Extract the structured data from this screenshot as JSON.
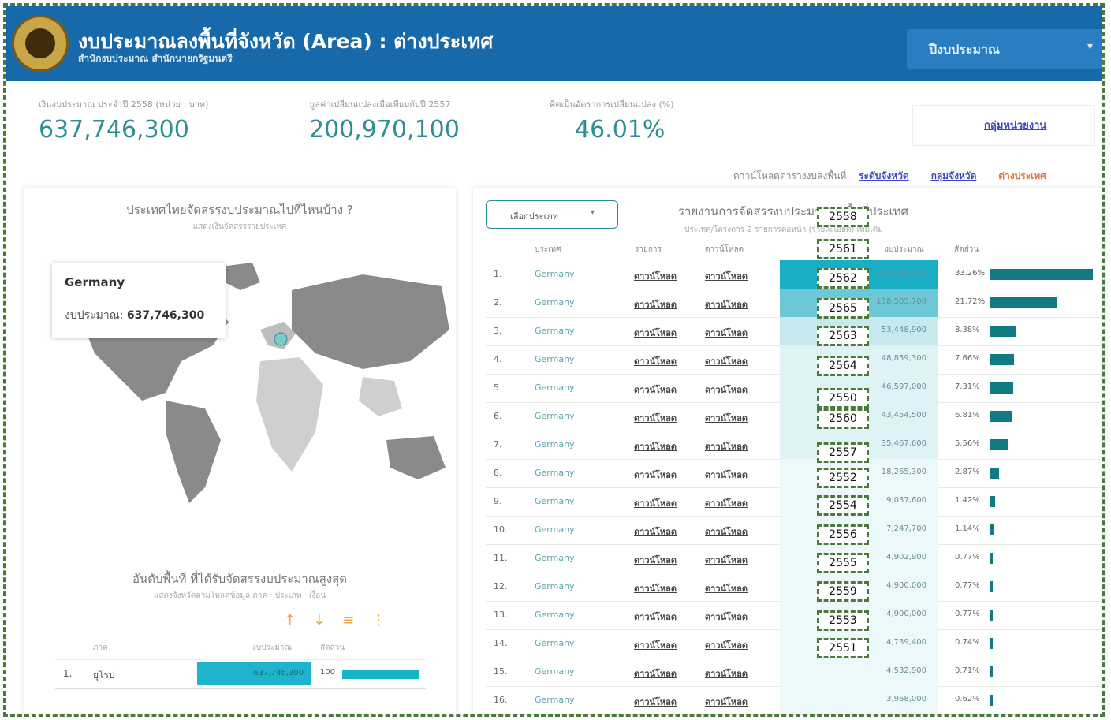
{
  "header": {
    "title": "งบประมาณลงพื้นที่จังหวัด (Area) : ต่างประเทศ",
    "subtitle": "สำนักงบประมาณ สำนักนายกรัฐมนตรี",
    "year_select": "ปีงบประมาณ"
  },
  "kpis": [
    {
      "label": "เงินงบประมาณ ประจำปี 2558 (หน่วย : บาท)",
      "value": "637,746,300"
    },
    {
      "label": "มูลค่าเปลี่ยนแปลงเมื่อเทียบกับปี 2557",
      "value": "200,970,100"
    },
    {
      "label": "คิดเป็นอัตราการเปลี่ยนแปลง (%)",
      "value": "46.01%"
    }
  ],
  "kpi_link": "กลุ่มหน่วยงาน",
  "breadcrumb": {
    "prefix": "ดาวน์โหลดตารางงบลงพื้นที่",
    "links": [
      "ระดับจังหวัด",
      "กลุ่มจังหวัด"
    ],
    "current": "ต่างประเทศ"
  },
  "map_panel": {
    "title": "ประเทศไทยจัดสรรงบประมาณไปที่ไหนบ้าง ?",
    "subtitle": "แสดงเงินจัดสรรรายประเทศ",
    "tooltip": {
      "country": "Germany",
      "budget_label": "งบประมาณ:",
      "budget_value": "637,746,300"
    }
  },
  "ranking": {
    "title": "อันดับพื้นที่ ที่ได้รับจัดสรรงบประมาณสูงสุด",
    "subtitle": "แสดงจังหวัดตามโหลดข้อมูล ภาค · ประเภท · เงื่อน",
    "headers": [
      "ภาค",
      "งบประมาณ",
      "สัดส่วน"
    ],
    "row": {
      "no": "1.",
      "name": "ยุโรป",
      "value": "637,746,300",
      "pct": "100",
      "share": 1.0
    }
  },
  "table": {
    "select_label": "เลือกประเภท",
    "title": "รายงานการจัดสรรงบประมาณลงพื้นที่ประเทศ",
    "subtitle": "ประเทศ/โครงการ 2 รายการต่อหน้า (รายละเอียด) เพิ่มเติม",
    "headers": [
      "ประเทศ",
      "รายการ",
      "ดาวน์โหลด",
      "งบประมาณ",
      "สัดส่วน"
    ],
    "link_text": "ดาวน์โหลด",
    "rows": [
      {
        "no": "1.",
        "country": "Germany",
        "budget": "212,022,000",
        "pct": "33.26%",
        "share": 0.3326,
        "shade": 0
      },
      {
        "no": "2.",
        "country": "Germany",
        "budget": "138,505,700",
        "pct": "21.72%",
        "share": 0.2172,
        "shade": 1
      },
      {
        "no": "3.",
        "country": "Germany",
        "budget": "53,448,900",
        "pct": "8.38%",
        "share": 0.0838,
        "shade": 2
      },
      {
        "no": "4.",
        "country": "Germany",
        "budget": "48,859,300",
        "pct": "7.66%",
        "share": 0.0766,
        "shade": 3
      },
      {
        "no": "5.",
        "country": "Germany",
        "budget": "46,597,000",
        "pct": "7.31%",
        "share": 0.0731,
        "shade": 3
      },
      {
        "no": "6.",
        "country": "Germany",
        "budget": "43,454,500",
        "pct": "6.81%",
        "share": 0.0681,
        "shade": 3
      },
      {
        "no": "7.",
        "country": "Germany",
        "budget": "35,467,600",
        "pct": "5.56%",
        "share": 0.0556,
        "shade": 3
      },
      {
        "no": "8.",
        "country": "Germany",
        "budget": "18,265,300",
        "pct": "2.87%",
        "share": 0.0287,
        "shade": 4
      },
      {
        "no": "9.",
        "country": "Germany",
        "budget": "9,037,600",
        "pct": "1.42%",
        "share": 0.0142,
        "shade": 4
      },
      {
        "no": "10.",
        "country": "Germany",
        "budget": "7,247,700",
        "pct": "1.14%",
        "share": 0.0114,
        "shade": 4
      },
      {
        "no": "11.",
        "country": "Germany",
        "budget": "4,902,900",
        "pct": "0.77%",
        "share": 0.0077,
        "shade": 4
      },
      {
        "no": "12.",
        "country": "Germany",
        "budget": "4,900,000",
        "pct": "0.77%",
        "share": 0.0077,
        "shade": 4
      },
      {
        "no": "13.",
        "country": "Germany",
        "budget": "4,900,000",
        "pct": "0.77%",
        "share": 0.0077,
        "shade": 4
      },
      {
        "no": "14.",
        "country": "Germany",
        "budget": "4,739,400",
        "pct": "0.74%",
        "share": 0.0074,
        "shade": 4
      },
      {
        "no": "15.",
        "country": "Germany",
        "budget": "4,532,900",
        "pct": "0.71%",
        "share": 0.0071,
        "shade": 4
      },
      {
        "no": "16.",
        "country": "Germany",
        "budget": "3,968,000",
        "pct": "0.62%",
        "share": 0.0062,
        "shade": 4
      }
    ]
  },
  "year_overlay": [
    "2558",
    "2561",
    "2562",
    "2565",
    "2563",
    "2564",
    "2550",
    "2560",
    "2557",
    "2552",
    "2554",
    "2556",
    "2555",
    "2559",
    "2553",
    "2551"
  ],
  "colors": {
    "header": "#1769aa",
    "accent": "#2d8e96",
    "bar": "#127a82",
    "link": "#3d49c9",
    "overlay_border": "#4a7a3a"
  }
}
